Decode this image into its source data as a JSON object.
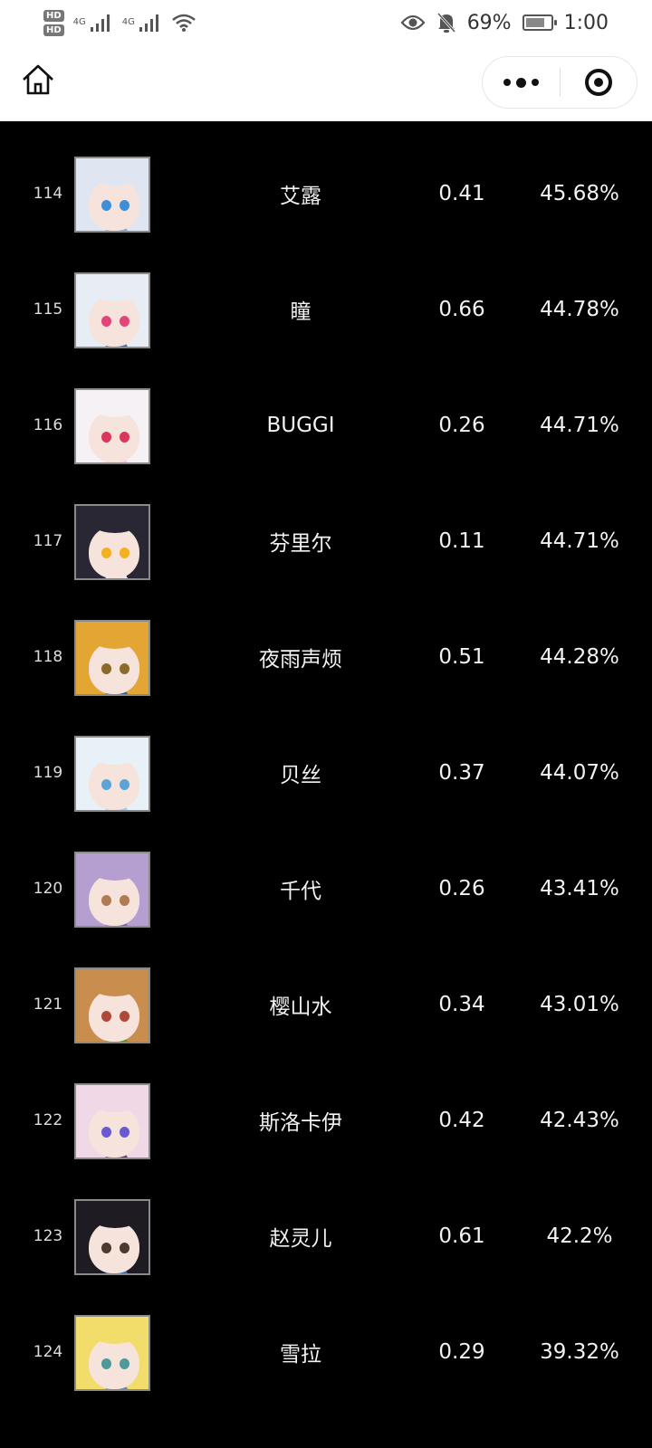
{
  "status_bar": {
    "hd1": "HD",
    "hd2": "HD",
    "net1": "4G",
    "net2": "4G",
    "battery_pct": "69%",
    "time": "1:00",
    "icons": [
      "signal-icon",
      "wifi-icon",
      "eye-icon",
      "bell-off-icon",
      "battery-icon"
    ]
  },
  "nav": {
    "home_icon": "home-icon",
    "more_icon": "more-dots-icon",
    "close_icon": "target-close-icon"
  },
  "rows": [
    {
      "rank": "114",
      "name": "艾露",
      "score": "0.41",
      "rate": "45.68%",
      "palette": {
        "bg": "#9aa9c4",
        "hair": "#dfe6f2",
        "eye": "#3c8fd8"
      }
    },
    {
      "rank": "115",
      "name": "瞳",
      "score": "0.66",
      "rate": "44.78%",
      "palette": {
        "bg": "#5a6d94",
        "hair": "#e7ecf5",
        "eye": "#e0467a"
      }
    },
    {
      "rank": "116",
      "name": "BUGGI",
      "score": "0.26",
      "rate": "44.71%",
      "palette": {
        "bg": "#f4cfe0",
        "hair": "#f6f1f4",
        "eye": "#d8385a"
      }
    },
    {
      "rank": "117",
      "name": "芬里尔",
      "score": "0.11",
      "rate": "44.71%",
      "palette": {
        "bg": "#e9e9ef",
        "hair": "#2a2735",
        "eye": "#f2b120"
      }
    },
    {
      "rank": "118",
      "name": "夜雨声烦",
      "score": "0.51",
      "rate": "44.28%",
      "palette": {
        "bg": "#3e5c86",
        "hair": "#e3a634",
        "eye": "#8a6b2a"
      }
    },
    {
      "rank": "119",
      "name": "贝丝",
      "score": "0.37",
      "rate": "44.07%",
      "palette": {
        "bg": "#a9c9e6",
        "hair": "#e8f0f8",
        "eye": "#5aa4d8"
      }
    },
    {
      "rank": "120",
      "name": "千代",
      "score": "0.26",
      "rate": "43.41%",
      "palette": {
        "bg": "#7d6b9a",
        "hair": "#b59fd0",
        "eye": "#b07a52"
      }
    },
    {
      "rank": "121",
      "name": "樱山水",
      "score": "0.34",
      "rate": "43.01%",
      "palette": {
        "bg": "#6e8a36",
        "hair": "#c98d4e",
        "eye": "#b0483a"
      }
    },
    {
      "rank": "122",
      "name": "斯洛卡伊",
      "score": "0.42",
      "rate": "42.43%",
      "palette": {
        "bg": "#5a4c6e",
        "hair": "#f1d8e6",
        "eye": "#6a5ad0"
      }
    },
    {
      "rank": "123",
      "name": "赵灵儿",
      "score": "0.61",
      "rate": "42.2%",
      "palette": {
        "bg": "#3c6aa4",
        "hair": "#1e1c22",
        "eye": "#4a3a30"
      }
    },
    {
      "rank": "124",
      "name": "雪拉",
      "score": "0.29",
      "rate": "39.32%",
      "palette": {
        "bg": "#6b84a2",
        "hair": "#f2dc6a",
        "eye": "#4e9a9a"
      }
    }
  ]
}
